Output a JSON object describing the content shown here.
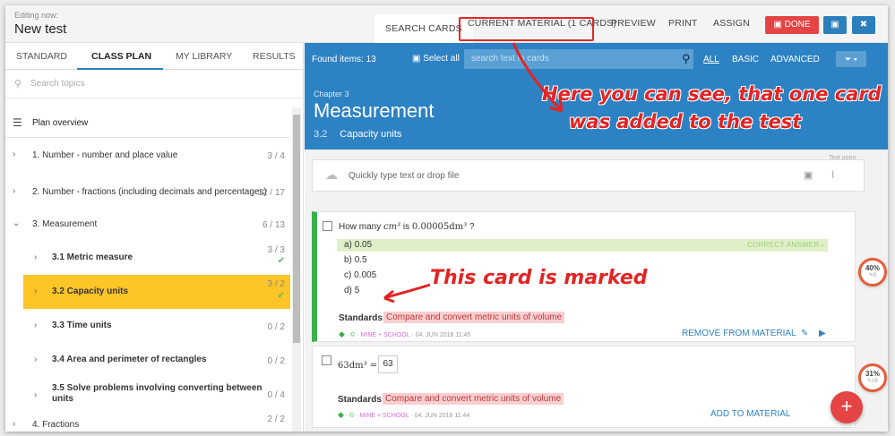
{
  "header": {
    "editing_label": "Editing now:",
    "title": "New test",
    "tabs": [
      "SEARCH CARDS",
      "CURRENT MATERIAL (1 CARDS)",
      "PREVIEW",
      "PRINT",
      "ASSIGN"
    ],
    "done_label": "DONE",
    "save_icon": "save-icon",
    "close_icon": "close-icon"
  },
  "left": {
    "tabs": [
      "STANDARD",
      "CLASS PLAN",
      "MY LIBRARY",
      "RESULTS"
    ],
    "search_placeholder": "Search topics",
    "plan_overview": "Plan overview",
    "items": [
      {
        "label": "1. Number - number and place value",
        "count": "3 / 4"
      },
      {
        "label": "2. Number - fractions (including decimals and percentages)",
        "count": "12 / 17"
      },
      {
        "label": "3. Measurement",
        "count": "6 / 13"
      },
      {
        "label": "3.1 Metric measure",
        "count": "3 / 3"
      },
      {
        "label": "3.2 Capacity units",
        "count": "3 / 2"
      },
      {
        "label": "3.3 Time units",
        "count": "0 / 2"
      },
      {
        "label": "3.4 Area and perimeter of rectangles",
        "count": "0 / 2"
      },
      {
        "label": "3.5 Solve problems involving converting between",
        "label2": "units",
        "count": "0 / 4"
      },
      {
        "label": "4. Fractions",
        "count": "2 / 2"
      }
    ]
  },
  "main": {
    "found": "Found items: 13",
    "select_all": "Select all",
    "search_placeholder": "search text in cards",
    "filters": [
      "ALL",
      "BASIC",
      "ADVANCED"
    ],
    "chapter": "Chapter 3",
    "title": "Measurement",
    "sub_num": "3.2",
    "sub_title": "Capacity units",
    "quick_placeholder": "Quickly type text or drop file",
    "text_open": "Text open"
  },
  "annotations": {
    "top_line1": "Here you can see, that one card",
    "top_line2": "was added to the test",
    "marked": "This card is marked"
  },
  "card1": {
    "question_pre": "How many",
    "question_unit": "cm³",
    "question_mid": "is",
    "question_val": "0.00005dm³",
    "question_end": "?",
    "answers": [
      {
        "letter": "a)",
        "value": "0.05"
      },
      {
        "letter": "b)",
        "value": "0.5"
      },
      {
        "letter": "c)",
        "value": "0.005"
      },
      {
        "letter": "d)",
        "value": "5"
      }
    ],
    "correct_label": "CORRECT ANSWER",
    "standards_label": "Standards:",
    "standard": "Compare and convert metric units of volume",
    "meta_owner": "MINE",
    "meta_school": "+ SCHOOL",
    "meta_date": "04. JUN 2018 11:45",
    "action": "REMOVE FROM MATERIAL"
  },
  "card2": {
    "question_val": "63dm³ =",
    "input_value": "63",
    "standards_label": "Standards:",
    "standard": "Compare and convert metric units of volume",
    "meta_owner": "MINE",
    "meta_school": "+ SCHOOL",
    "meta_date": "04. JUN 2018 11:44",
    "action": "ADD TO MATERIAL"
  },
  "progress": [
    {
      "percent": "40%",
      "sub": "5"
    },
    {
      "percent": "31%",
      "sub": "16"
    }
  ],
  "colors": {
    "primary": "#2d82c3",
    "danger": "#e54444",
    "selected": "#fdc526",
    "success": "#3ab04d"
  }
}
